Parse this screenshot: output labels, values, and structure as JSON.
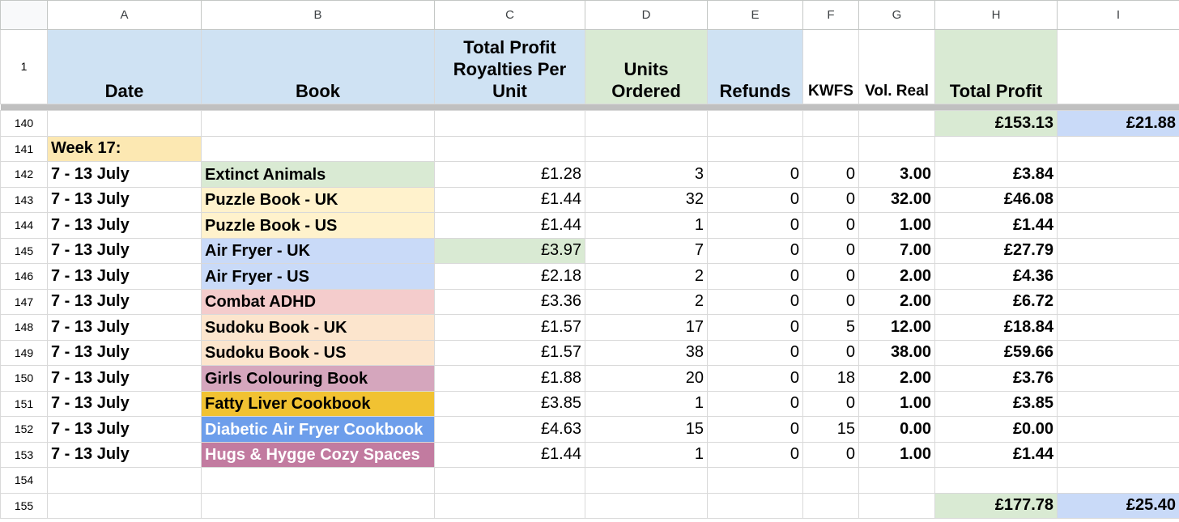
{
  "columns": [
    "A",
    "B",
    "C",
    "D",
    "E",
    "F",
    "G",
    "H",
    "I"
  ],
  "headers": {
    "row_number": "1",
    "date": "Date",
    "book": "Book",
    "royalties": "Total Profit Royalties Per Unit",
    "units": "Units Ordered",
    "refunds": "Refunds",
    "kwfs": "KWFS",
    "vol_real": "Vol. Real",
    "total_profit": "Total Profit"
  },
  "summary_top": {
    "row": "140",
    "total_profit": "£153.13",
    "extra": "£21.88"
  },
  "week_row": {
    "row": "141",
    "label": "Week 17:"
  },
  "rows": [
    {
      "row": "142",
      "date": "7 - 13 July",
      "book": "Extinct Animals",
      "book_color": "#d9ead3",
      "royalty": "£1.28",
      "units": "3",
      "refunds": "0",
      "kwfs": "0",
      "vol": "3.00",
      "profit": "£3.84"
    },
    {
      "row": "143",
      "date": "7 - 13 July",
      "book": "Puzzle Book - UK",
      "book_color": "#fff2cc",
      "royalty": "£1.44",
      "units": "32",
      "refunds": "0",
      "kwfs": "0",
      "vol": "32.00",
      "profit": "£46.08"
    },
    {
      "row": "144",
      "date": "7 - 13 July",
      "book": "Puzzle Book - US",
      "book_color": "#fff2cc",
      "royalty": "£1.44",
      "units": "1",
      "refunds": "0",
      "kwfs": "0",
      "vol": "1.00",
      "profit": "£1.44"
    },
    {
      "row": "145",
      "date": "7 - 13 July",
      "book": "Air Fryer - UK",
      "book_color": "#c9daf8",
      "royalty": "£3.97",
      "royalty_color": "#d9ead3",
      "units": "7",
      "refunds": "0",
      "kwfs": "0",
      "vol": "7.00",
      "profit": "£27.79"
    },
    {
      "row": "146",
      "date": "7 - 13 July",
      "book": "Air Fryer - US",
      "book_color": "#c9daf8",
      "royalty": "£2.18",
      "units": "2",
      "refunds": "0",
      "kwfs": "0",
      "vol": "2.00",
      "profit": "£4.36"
    },
    {
      "row": "147",
      "date": "7 - 13 July",
      "book": "Combat ADHD",
      "book_color": "#f4cccc",
      "royalty": "£3.36",
      "units": "2",
      "refunds": "0",
      "kwfs": "0",
      "vol": "2.00",
      "profit": "£6.72"
    },
    {
      "row": "148",
      "date": "7 - 13 July",
      "book": "Sudoku Book - UK",
      "book_color": "#fce5cd",
      "royalty": "£1.57",
      "units": "17",
      "refunds": "0",
      "kwfs": "5",
      "vol": "12.00",
      "profit": "£18.84"
    },
    {
      "row": "149",
      "date": "7 - 13 July",
      "book": "Sudoku Book - US",
      "book_color": "#fce5cd",
      "royalty": "£1.57",
      "units": "38",
      "refunds": "0",
      "kwfs": "0",
      "vol": "38.00",
      "profit": "£59.66"
    },
    {
      "row": "150",
      "date": "7 - 13 July",
      "book": "Girls Colouring Book",
      "book_color": "#d5a6bd",
      "royalty": "£1.88",
      "units": "20",
      "refunds": "0",
      "kwfs": "18",
      "vol": "2.00",
      "profit": "£3.76"
    },
    {
      "row": "151",
      "date": "7 - 13 July",
      "book": "Fatty Liver Cookbook",
      "book_color": "#f1c232",
      "royalty": "£3.85",
      "units": "1",
      "refunds": "0",
      "kwfs": "0",
      "vol": "1.00",
      "profit": "£3.85"
    },
    {
      "row": "152",
      "date": "7 - 13 July",
      "book": "Diabetic Air Fryer Cookbook",
      "book_color": "#6d9eeb",
      "book_text": "light",
      "royalty": "£4.63",
      "units": "15",
      "refunds": "0",
      "kwfs": "15",
      "vol": "0.00",
      "profit": "£0.00"
    },
    {
      "row": "153",
      "date": "7 - 13 July",
      "book": "Hugs & Hygge Cozy Spaces",
      "book_color": "#c27ba0",
      "book_text": "light",
      "royalty": "£1.44",
      "units": "1",
      "refunds": "0",
      "kwfs": "0",
      "vol": "1.00",
      "profit": "£1.44"
    }
  ],
  "blank_row": {
    "row": "154"
  },
  "summary_bottom": {
    "row": "155",
    "total_profit": "£177.78",
    "extra": "£25.40"
  }
}
